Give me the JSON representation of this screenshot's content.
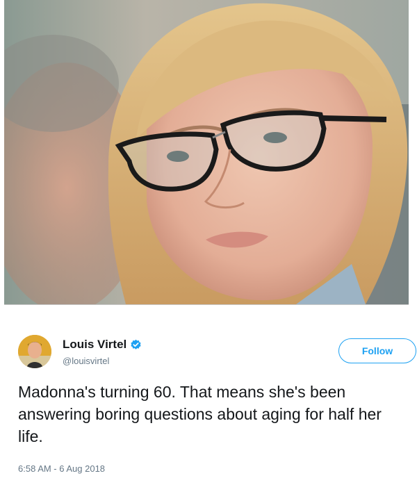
{
  "photo": {
    "description_icon": "portrait-photo"
  },
  "tweet": {
    "author": {
      "display_name": "Louis Virtel",
      "handle": "@louisvirtel",
      "verified_icon": "verified-badge-icon"
    },
    "follow_label": "Follow",
    "text": "Madonna's turning 60. That means she's been answering boring questions about aging for half her life.",
    "timestamp": "6:58 AM - 6 Aug 2018"
  },
  "colors": {
    "accent": "#1da1f2",
    "secondary_text": "#657786",
    "primary_text": "#14171a"
  }
}
